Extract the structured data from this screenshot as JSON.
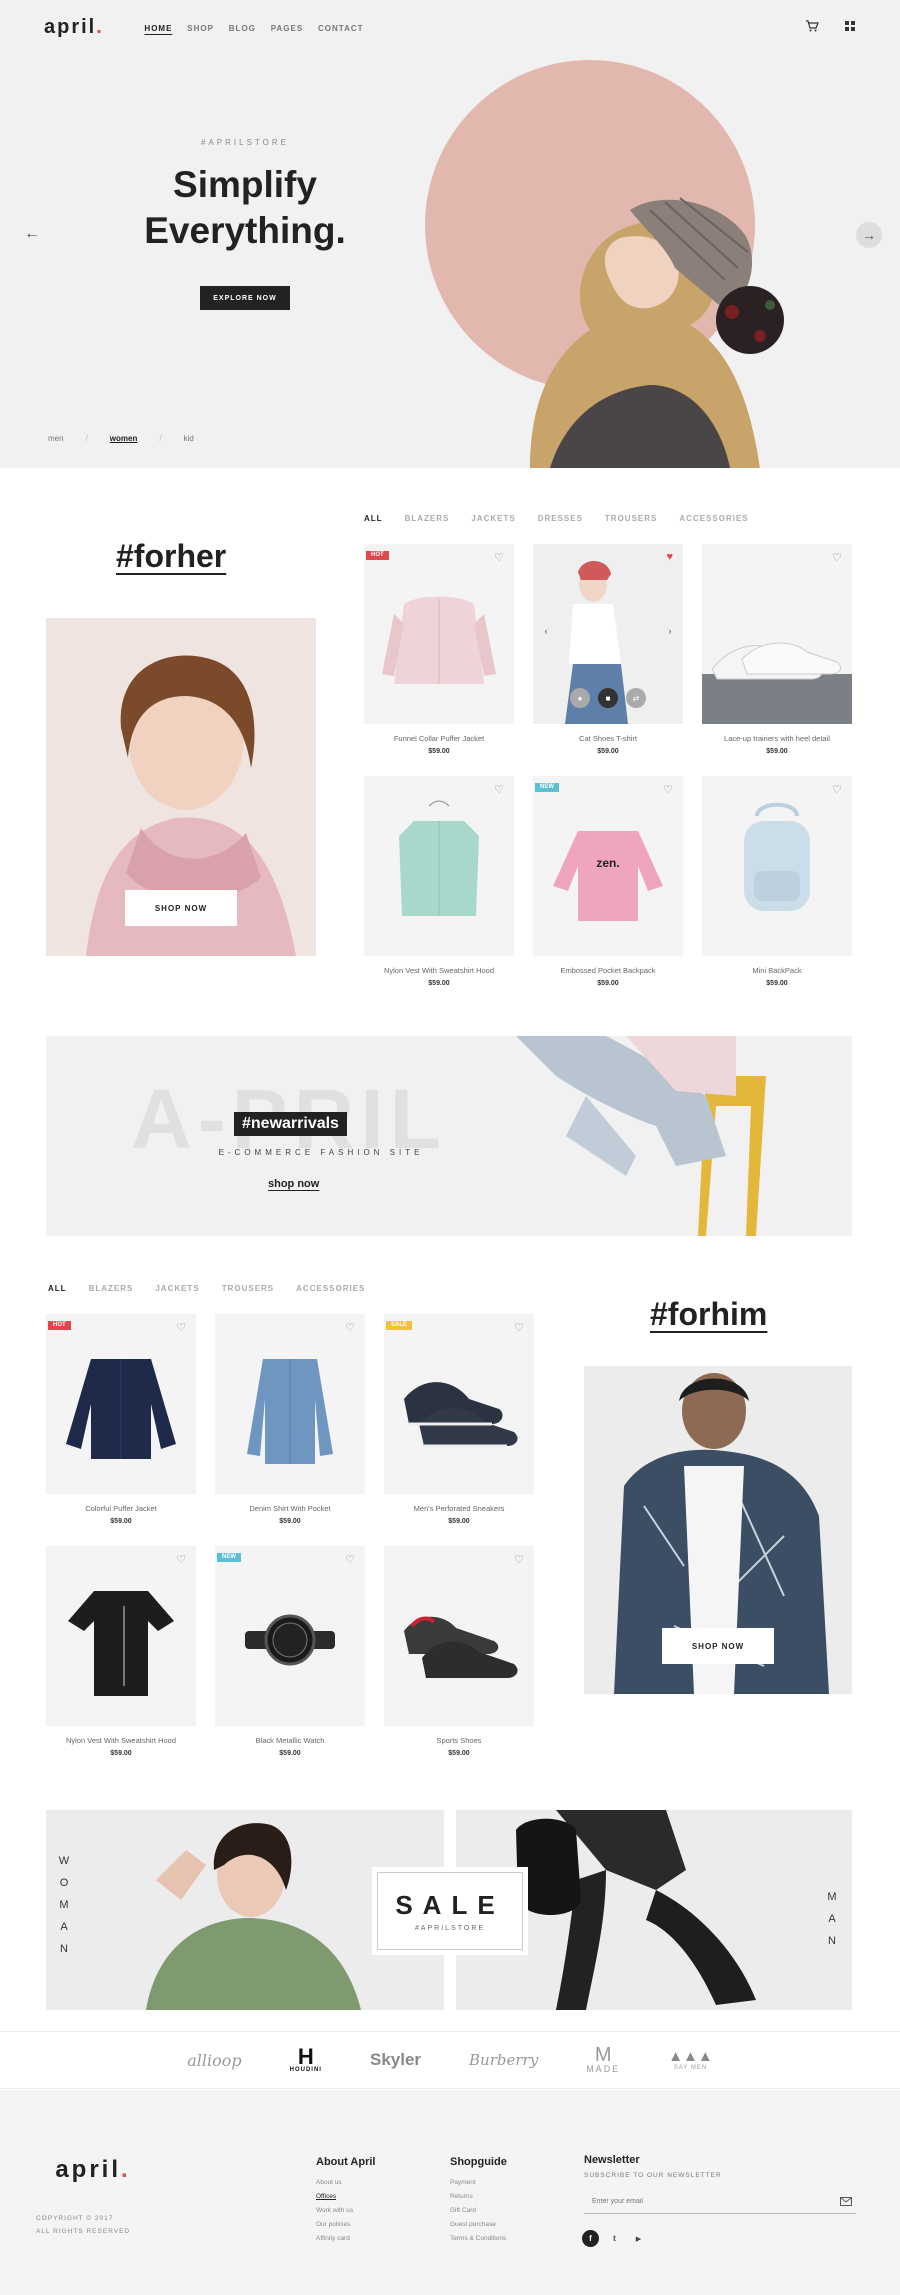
{
  "brand": {
    "logo_text": "april",
    "logo_dot": "."
  },
  "nav": {
    "items": [
      {
        "label": "HOME",
        "active": true
      },
      {
        "label": "SHOP",
        "active": false
      },
      {
        "label": "BLOG",
        "active": false
      },
      {
        "label": "PAGES",
        "active": false
      },
      {
        "label": "CONTACT",
        "active": false
      }
    ],
    "cart_icon": "cart-icon",
    "menu_icon": "grid-menu-icon"
  },
  "hero": {
    "tag": "#APRILSTORE",
    "title_line1": "Simplify",
    "title_line2": "Everything.",
    "button": "EXPLORE NOW",
    "prev_icon": "arrow-left-icon",
    "next_icon": "arrow-right-icon",
    "gender_links": [
      "men",
      "women",
      "kid"
    ],
    "active_gender": "women",
    "accent_color": "#e2b8ae"
  },
  "for_her": {
    "tag": "#forher",
    "shop_button": "SHOP NOW",
    "tabs": [
      "ALL",
      "BLAZERS",
      "JACKETS",
      "DRESSES",
      "TROUSERS",
      "ACCESSORIES"
    ],
    "active_tab": "ALL",
    "products": [
      {
        "name": "Funnel Collar Puffer Jacket",
        "price": "$59.00",
        "badge": "HOT"
      },
      {
        "name": "Cat Shoes T-shirt",
        "price": "$59.00",
        "badge": ""
      },
      {
        "name": "Lace-up trainers with heel detail",
        "price": "$59.00",
        "badge": ""
      },
      {
        "name": "Nylon Vest With Sweatshirt Hood",
        "price": "$59.00",
        "badge": ""
      },
      {
        "name": "Embossed Pocket Backpack",
        "price": "$59.00",
        "badge": "NEW"
      },
      {
        "name": "Mini BackPack",
        "price": "$59.00",
        "badge": ""
      }
    ],
    "tee_print": "zen."
  },
  "new_arrivals": {
    "watermark": "A-PRIL",
    "tag": "#newarrivals",
    "subtitle": "E-COMMERCE FASHION SITE",
    "link": "shop now"
  },
  "for_him": {
    "tag": "#forhim",
    "shop_button": "SHOP NOW",
    "tabs": [
      "ALL",
      "BLAZERS",
      "JACKETS",
      "TROUSERS",
      "ACCESSORIES"
    ],
    "active_tab": "ALL",
    "products": [
      {
        "name": "Colorful Puffer Jacket",
        "price": "$59.00",
        "badge": "HOT"
      },
      {
        "name": "Denim Shirt With Pocket",
        "price": "$59.00",
        "badge": ""
      },
      {
        "name": "Men's Perforated Sneakers",
        "price": "$59.00",
        "badge": "SALE"
      },
      {
        "name": "Nylon Vest With Sweatshirt Hood",
        "price": "$59.00",
        "badge": ""
      },
      {
        "name": "Black Metallic Watch",
        "price": "$59.00",
        "badge": "NEW"
      },
      {
        "name": "Sports Shoes",
        "price": "$59.00",
        "badge": ""
      }
    ]
  },
  "sale_banner": {
    "left_label": "WOMAN",
    "right_label": "MAN",
    "title": "SALE",
    "subtitle": "#APRILSTORE"
  },
  "brands": {
    "logos": [
      "allioop",
      "HOUDINI",
      "Skyler",
      "Burberry",
      "MADE",
      "SAY MEN"
    ]
  },
  "footer": {
    "logo_text": "april",
    "logo_dot": ".",
    "copyright_line1": "COPYRIGHT © 2017",
    "copyright_line2": "ALL RIGHTS RESERVED",
    "about": {
      "heading": "About April",
      "links": [
        "About us",
        "Offices",
        "Work with us",
        "Our policies",
        "Affinity card"
      ]
    },
    "shop": {
      "heading": "Shopguide",
      "links": [
        "Payment",
        "Returns",
        "Gift Card",
        "Guest purchase",
        "Terms & Conditions"
      ]
    },
    "newsletter": {
      "heading": "Newsletter",
      "subtitle": "SUBSCRIBE TO OUR NEWSLETTER",
      "placeholder": "Enter your email"
    },
    "social": [
      "facebook-icon",
      "twitter-icon",
      "youtube-icon"
    ]
  },
  "colors": {
    "hot": "#e0494c",
    "new": "#5bc0d6",
    "sale": "#f0c040",
    "heart_active": "#e0494c"
  }
}
